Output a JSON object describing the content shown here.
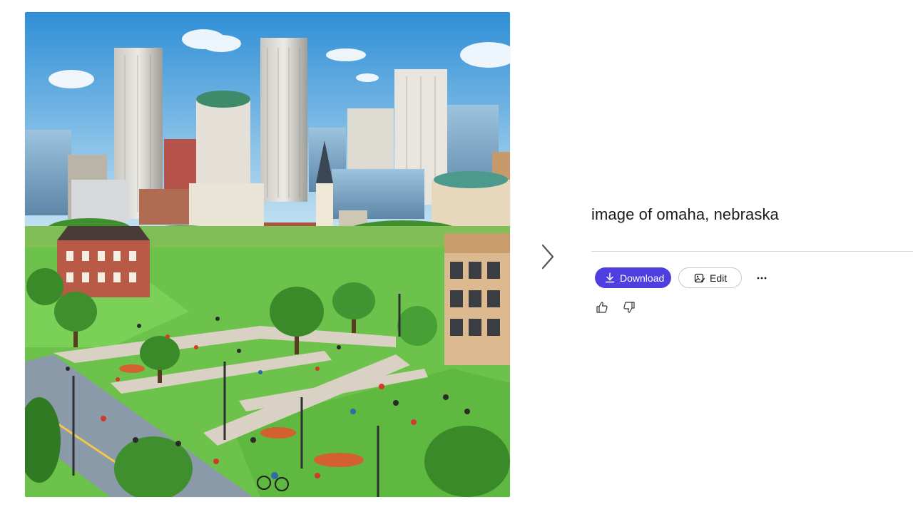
{
  "image": {
    "icon": "generated-image",
    "palette": {
      "sky_top": "#2f8fd6",
      "sky_bottom": "#cfe8f5",
      "grass": "#6cc24a",
      "river": "#4aa8d8",
      "path": "#d9d2c4"
    }
  },
  "navigation": {
    "next_icon": "chevron-right-icon"
  },
  "panel": {
    "prompt": "image of omaha, nebraska",
    "actions": {
      "download_label": "Download",
      "download_icon": "download-icon",
      "edit_label": "Edit",
      "edit_icon": "edit-image-icon",
      "more_icon": "more-options-icon",
      "accent_color": "#4f3fe0"
    },
    "feedback": {
      "like_icon": "thumbs-up-icon",
      "dislike_icon": "thumbs-down-icon"
    }
  }
}
